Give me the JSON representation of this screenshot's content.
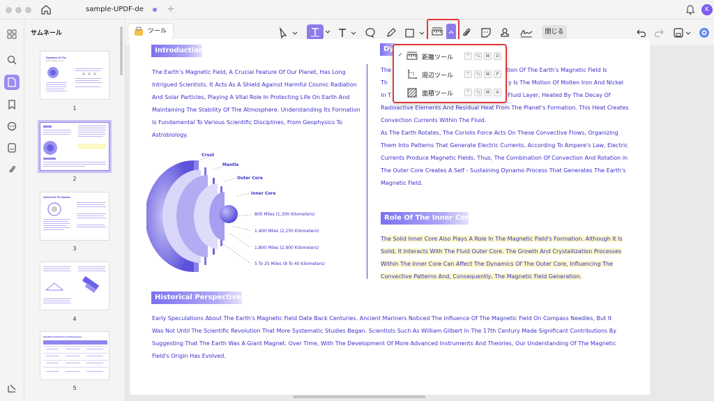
{
  "window": {
    "tab_title": "sample-UPDF-de",
    "avatar_letter": "K"
  },
  "thumbnails": {
    "title": "サムネール",
    "pages": [
      {
        "num": "1",
        "heading": "Dynamics Of The Earth's Magnetic Field"
      },
      {
        "num": "2",
        "heading": ""
      },
      {
        "num": "3",
        "heading": "Sources For The Dynamo"
      },
      {
        "num": "4",
        "heading": ""
      },
      {
        "num": "5",
        "heading": "Scientific Contributions And Researchers"
      }
    ]
  },
  "toolbar": {
    "tools_label": "ツール",
    "close_label": "閉じる"
  },
  "measure_menu": {
    "items": [
      {
        "label": "距離ツール",
        "checked": true,
        "keys": [
          "^",
          "⌥",
          "⌘",
          "D"
        ]
      },
      {
        "label": "周辺ツール",
        "checked": false,
        "keys": [
          "^",
          "⌥",
          "⌘",
          "P"
        ]
      },
      {
        "label": "面積ツール",
        "checked": false,
        "keys": [
          "^",
          "⌥",
          "⌘",
          "A"
        ]
      }
    ]
  },
  "document": {
    "intro_heading": "Introduction",
    "intro_lines": [
      "The Earth's Magnetic Field, A Crucial Feature Of Our Planet, Has Long",
      "Intrigued Scientists. It Acts As A Shield Against Harmful Cosmic Radiation",
      "And Solar Particles, Playing A Vital Role In Protecting Life On Earth And",
      "Maintaining The Stability Of The Atmosphere. Understanding Its Formation",
      "Is Fundamental To Various Scientific Disciplines, From Geophysics To",
      "Astrobiology."
    ],
    "right_heading_visible": "Dy",
    "right_lines": [
      {
        "pre": "The",
        "post": "mation Of The Earth's Magnetic Field Is"
      },
      {
        "pre": "Th",
        "post": "y Is The Motion Of Molten Iron And Nickel"
      },
      {
        "pre": "In T",
        "post": "Fluid Layer, Heated By The Decay Of"
      },
      {
        "pre": "Radioactive Elements And Residual Heat From The Planet's Formation. This Heat Creates",
        "post": ""
      },
      {
        "pre": "Convection Currents Within The Fluid.",
        "post": ""
      },
      {
        "pre": "As The Earth Rotates, The Coriolis Force Acts On These Convective Flows, Organizing",
        "post": ""
      },
      {
        "pre": "Them Into Patterns That Generate Electric Currents. According To Ampere's Law, Electric",
        "post": ""
      },
      {
        "pre": "Currents Produce Magnetic Fields. Thus, The Combination Of Convection And Rotation in",
        "post": ""
      },
      {
        "pre": "The Outer Core Creates A Self - Sustaining Dynamo Process That Generates The Earth's",
        "post": ""
      },
      {
        "pre": "Magnetic Field.",
        "post": ""
      }
    ],
    "inner_heading": "Role Of The Inner Core",
    "inner_lines": [
      "The Solid Inner Core Also Plays A Role In The Magnetic Field's Formation. Although It Is",
      "Solid, It Interacts With The Fluid Outer Core. The Growth And Crystallization Processes",
      "Within The Inner Core Can Affect The Dynamics Of The Outer Core, Influencing The",
      "Convective Patterns And, Consequently, The Magnetic Field Generation."
    ],
    "diagram": {
      "labels": [
        "Crust",
        "Mantle",
        "Outer Core",
        "Inner Core"
      ],
      "distances": [
        "800 Miles (1,300 Kilometers)",
        "1,400 Miles (2,250 Kilometers)",
        "1,800 Miles (2,900 Kilometers)",
        "5 To 25 Miles (8 To 40 Kilometers)"
      ]
    },
    "hist_heading": "Historical Perspectives",
    "hist_lines": [
      "Early Speculations About The Earth's Magnetic Field Date Back Centuries. Ancient Mariners Noticed The Influence Of The Magnetic Field On Compass Needles, But It",
      "Was Not Until The Scientific Revolution That More Systematic Studies Began. Scientists Such As William Gilbert In The 17th Century Made Significant Contributions By",
      "Suggesting That The Earth Was A Giant Magnet. Over Time, With The Development Of More Advanced Instruments And Theories, Our Understanding Of The Magnetic",
      "Field's Origin Has Evolved."
    ]
  }
}
